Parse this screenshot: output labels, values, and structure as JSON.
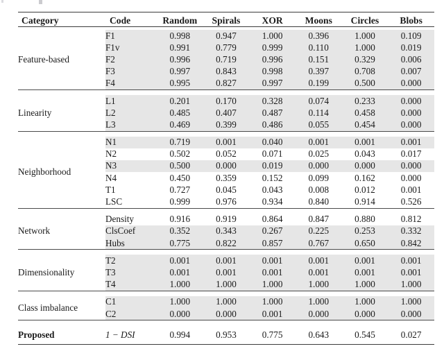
{
  "table": {
    "columns": [
      "Category",
      "Code",
      "Random",
      "Spirals",
      "XOR",
      "Moons",
      "Circles",
      "Blobs"
    ],
    "groups": [
      {
        "category": "Feature-based",
        "rows": [
          {
            "code": "F1",
            "values": [
              "0.998",
              "0.947",
              "1.000",
              "0.396",
              "1.000",
              "0.109"
            ],
            "shaded": true
          },
          {
            "code": "F1v",
            "values": [
              "0.991",
              "0.779",
              "0.999",
              "0.110",
              "1.000",
              "0.019"
            ],
            "shaded": true
          },
          {
            "code": "F2",
            "values": [
              "0.996",
              "0.719",
              "0.996",
              "0.151",
              "0.329",
              "0.006"
            ],
            "shaded": true
          },
          {
            "code": "F3",
            "values": [
              "0.997",
              "0.843",
              "0.998",
              "0.397",
              "0.708",
              "0.007"
            ],
            "shaded": true
          },
          {
            "code": "F4",
            "values": [
              "0.995",
              "0.827",
              "0.997",
              "0.199",
              "0.500",
              "0.000"
            ],
            "shaded": true
          }
        ]
      },
      {
        "category": "Linearity",
        "rows": [
          {
            "code": "L1",
            "values": [
              "0.201",
              "0.170",
              "0.328",
              "0.074",
              "0.233",
              "0.000"
            ],
            "shaded": true
          },
          {
            "code": "L2",
            "values": [
              "0.485",
              "0.407",
              "0.487",
              "0.114",
              "0.458",
              "0.000"
            ],
            "shaded": true
          },
          {
            "code": "L3",
            "values": [
              "0.469",
              "0.399",
              "0.486",
              "0.055",
              "0.454",
              "0.000"
            ],
            "shaded": true
          }
        ]
      },
      {
        "category": "Neighborhood",
        "rows": [
          {
            "code": "N1",
            "values": [
              "0.719",
              "0.001",
              "0.040",
              "0.001",
              "0.001",
              "0.001"
            ],
            "shaded": true
          },
          {
            "code": "N2",
            "values": [
              "0.502",
              "0.052",
              "0.071",
              "0.025",
              "0.043",
              "0.017"
            ],
            "shaded": false
          },
          {
            "code": "N3",
            "values": [
              "0.500",
              "0.000",
              "0.019",
              "0.000",
              "0.000",
              "0.000"
            ],
            "shaded": true
          },
          {
            "code": "N4",
            "values": [
              "0.450",
              "0.359",
              "0.152",
              "0.099",
              "0.162",
              "0.000"
            ],
            "shaded": false
          },
          {
            "code": "T1",
            "values": [
              "0.727",
              "0.045",
              "0.043",
              "0.008",
              "0.012",
              "0.001"
            ],
            "shaded": false
          },
          {
            "code": "LSC",
            "values": [
              "0.999",
              "0.976",
              "0.934",
              "0.840",
              "0.914",
              "0.526"
            ],
            "shaded": false
          }
        ]
      },
      {
        "category": "Network",
        "rows": [
          {
            "code": "Density",
            "values": [
              "0.916",
              "0.919",
              "0.864",
              "0.847",
              "0.880",
              "0.812"
            ],
            "shaded": false
          },
          {
            "code": "ClsCoef",
            "values": [
              "0.352",
              "0.343",
              "0.267",
              "0.225",
              "0.253",
              "0.332"
            ],
            "shaded": true
          },
          {
            "code": "Hubs",
            "values": [
              "0.775",
              "0.822",
              "0.857",
              "0.767",
              "0.650",
              "0.842"
            ],
            "shaded": true
          }
        ]
      },
      {
        "category": "Dimensionality",
        "rows": [
          {
            "code": "T2",
            "values": [
              "0.001",
              "0.001",
              "0.001",
              "0.001",
              "0.001",
              "0.001"
            ],
            "shaded": true
          },
          {
            "code": "T3",
            "values": [
              "0.001",
              "0.001",
              "0.001",
              "0.001",
              "0.001",
              "0.001"
            ],
            "shaded": true
          },
          {
            "code": "T4",
            "values": [
              "1.000",
              "1.000",
              "1.000",
              "1.000",
              "1.000",
              "1.000"
            ],
            "shaded": true
          }
        ]
      },
      {
        "category": "Class imbalance",
        "rows": [
          {
            "code": "C1",
            "values": [
              "1.000",
              "1.000",
              "1.000",
              "1.000",
              "1.000",
              "1.000"
            ],
            "shaded": true
          },
          {
            "code": "C2",
            "values": [
              "0.000",
              "0.000",
              "0.001",
              "0.000",
              "0.000",
              "0.000"
            ],
            "shaded": true
          }
        ]
      }
    ],
    "proposed": {
      "category": "Proposed",
      "code": "1 − DSI",
      "values": [
        "0.994",
        "0.953",
        "0.775",
        "0.643",
        "0.545",
        "0.027"
      ]
    }
  },
  "colors": {
    "rule": "#3a3a3a",
    "shade": "#e6e6e6",
    "text": "#1a1a1a"
  }
}
